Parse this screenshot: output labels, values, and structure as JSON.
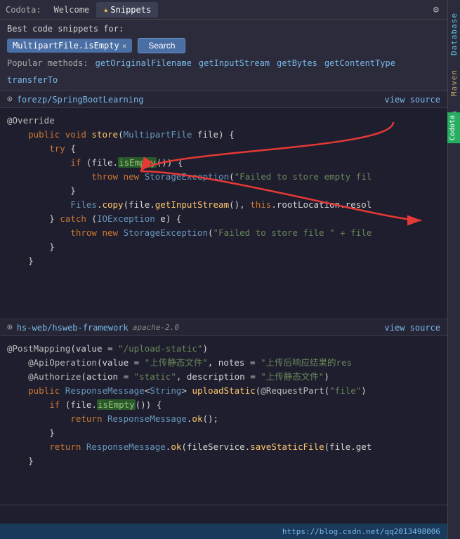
{
  "topbar": {
    "app_name": "Codota:",
    "tabs": [
      {
        "label": "Welcome",
        "active": false
      },
      {
        "label": "Snippets",
        "active": true,
        "star": true
      }
    ],
    "icons": [
      "⚙",
      "⋮"
    ]
  },
  "search": {
    "label": "Best code snippets for:",
    "tag": "MultipartFile.isEmpty",
    "button_label": "Search",
    "popular_label": "Popular methods:",
    "popular_methods": [
      "getOriginalFilename",
      "getInputStream",
      "getBytes",
      "getContentType",
      "transferTo"
    ]
  },
  "snippet1": {
    "repo": "forezp/SpringBootLearning",
    "view_source": "view source",
    "code_lines": [
      "@Override",
      "    public void store(MultipartFile file) {",
      "        try {",
      "            if (file.isEmpty()) {",
      "                throw new StorageException(\"Failed to store empty fil",
      "            }",
      "            Files.copy(file.getInputStream(), this.rootLocation.resol",
      "        } catch (IOException e) {",
      "            throw new StorageException(\"Failed to store file \" + file",
      "        }",
      "    }"
    ]
  },
  "snippet2": {
    "repo": "hs-web/hsweb-framework",
    "license": "apache-2.0",
    "view_source": "view source",
    "code_lines": [
      "@PostMapping(value = \"/upload-static\")",
      "    @ApiOperation(value = \"上传静态文件\", notes = \"上传后响应结果的res",
      "    @Authorize(action = \"static\", description = \"上传静态文件\")",
      "    public ResponseMessage<String> uploadStatic(@RequestPart(\"file\")",
      "        if (file.isEmpty()) {",
      "            return ResponseMessage.ok();",
      "        }",
      "",
      "        return ResponseMessage.ok(fileService.saveStaticFile(file.get",
      "    }"
    ]
  },
  "statusbar": {
    "url": "https://blog.csdn.net/qq2013498006"
  },
  "right_panel": {
    "labels": [
      "Database",
      "Maven",
      "Codota"
    ]
  },
  "codota_badge": "Codota"
}
